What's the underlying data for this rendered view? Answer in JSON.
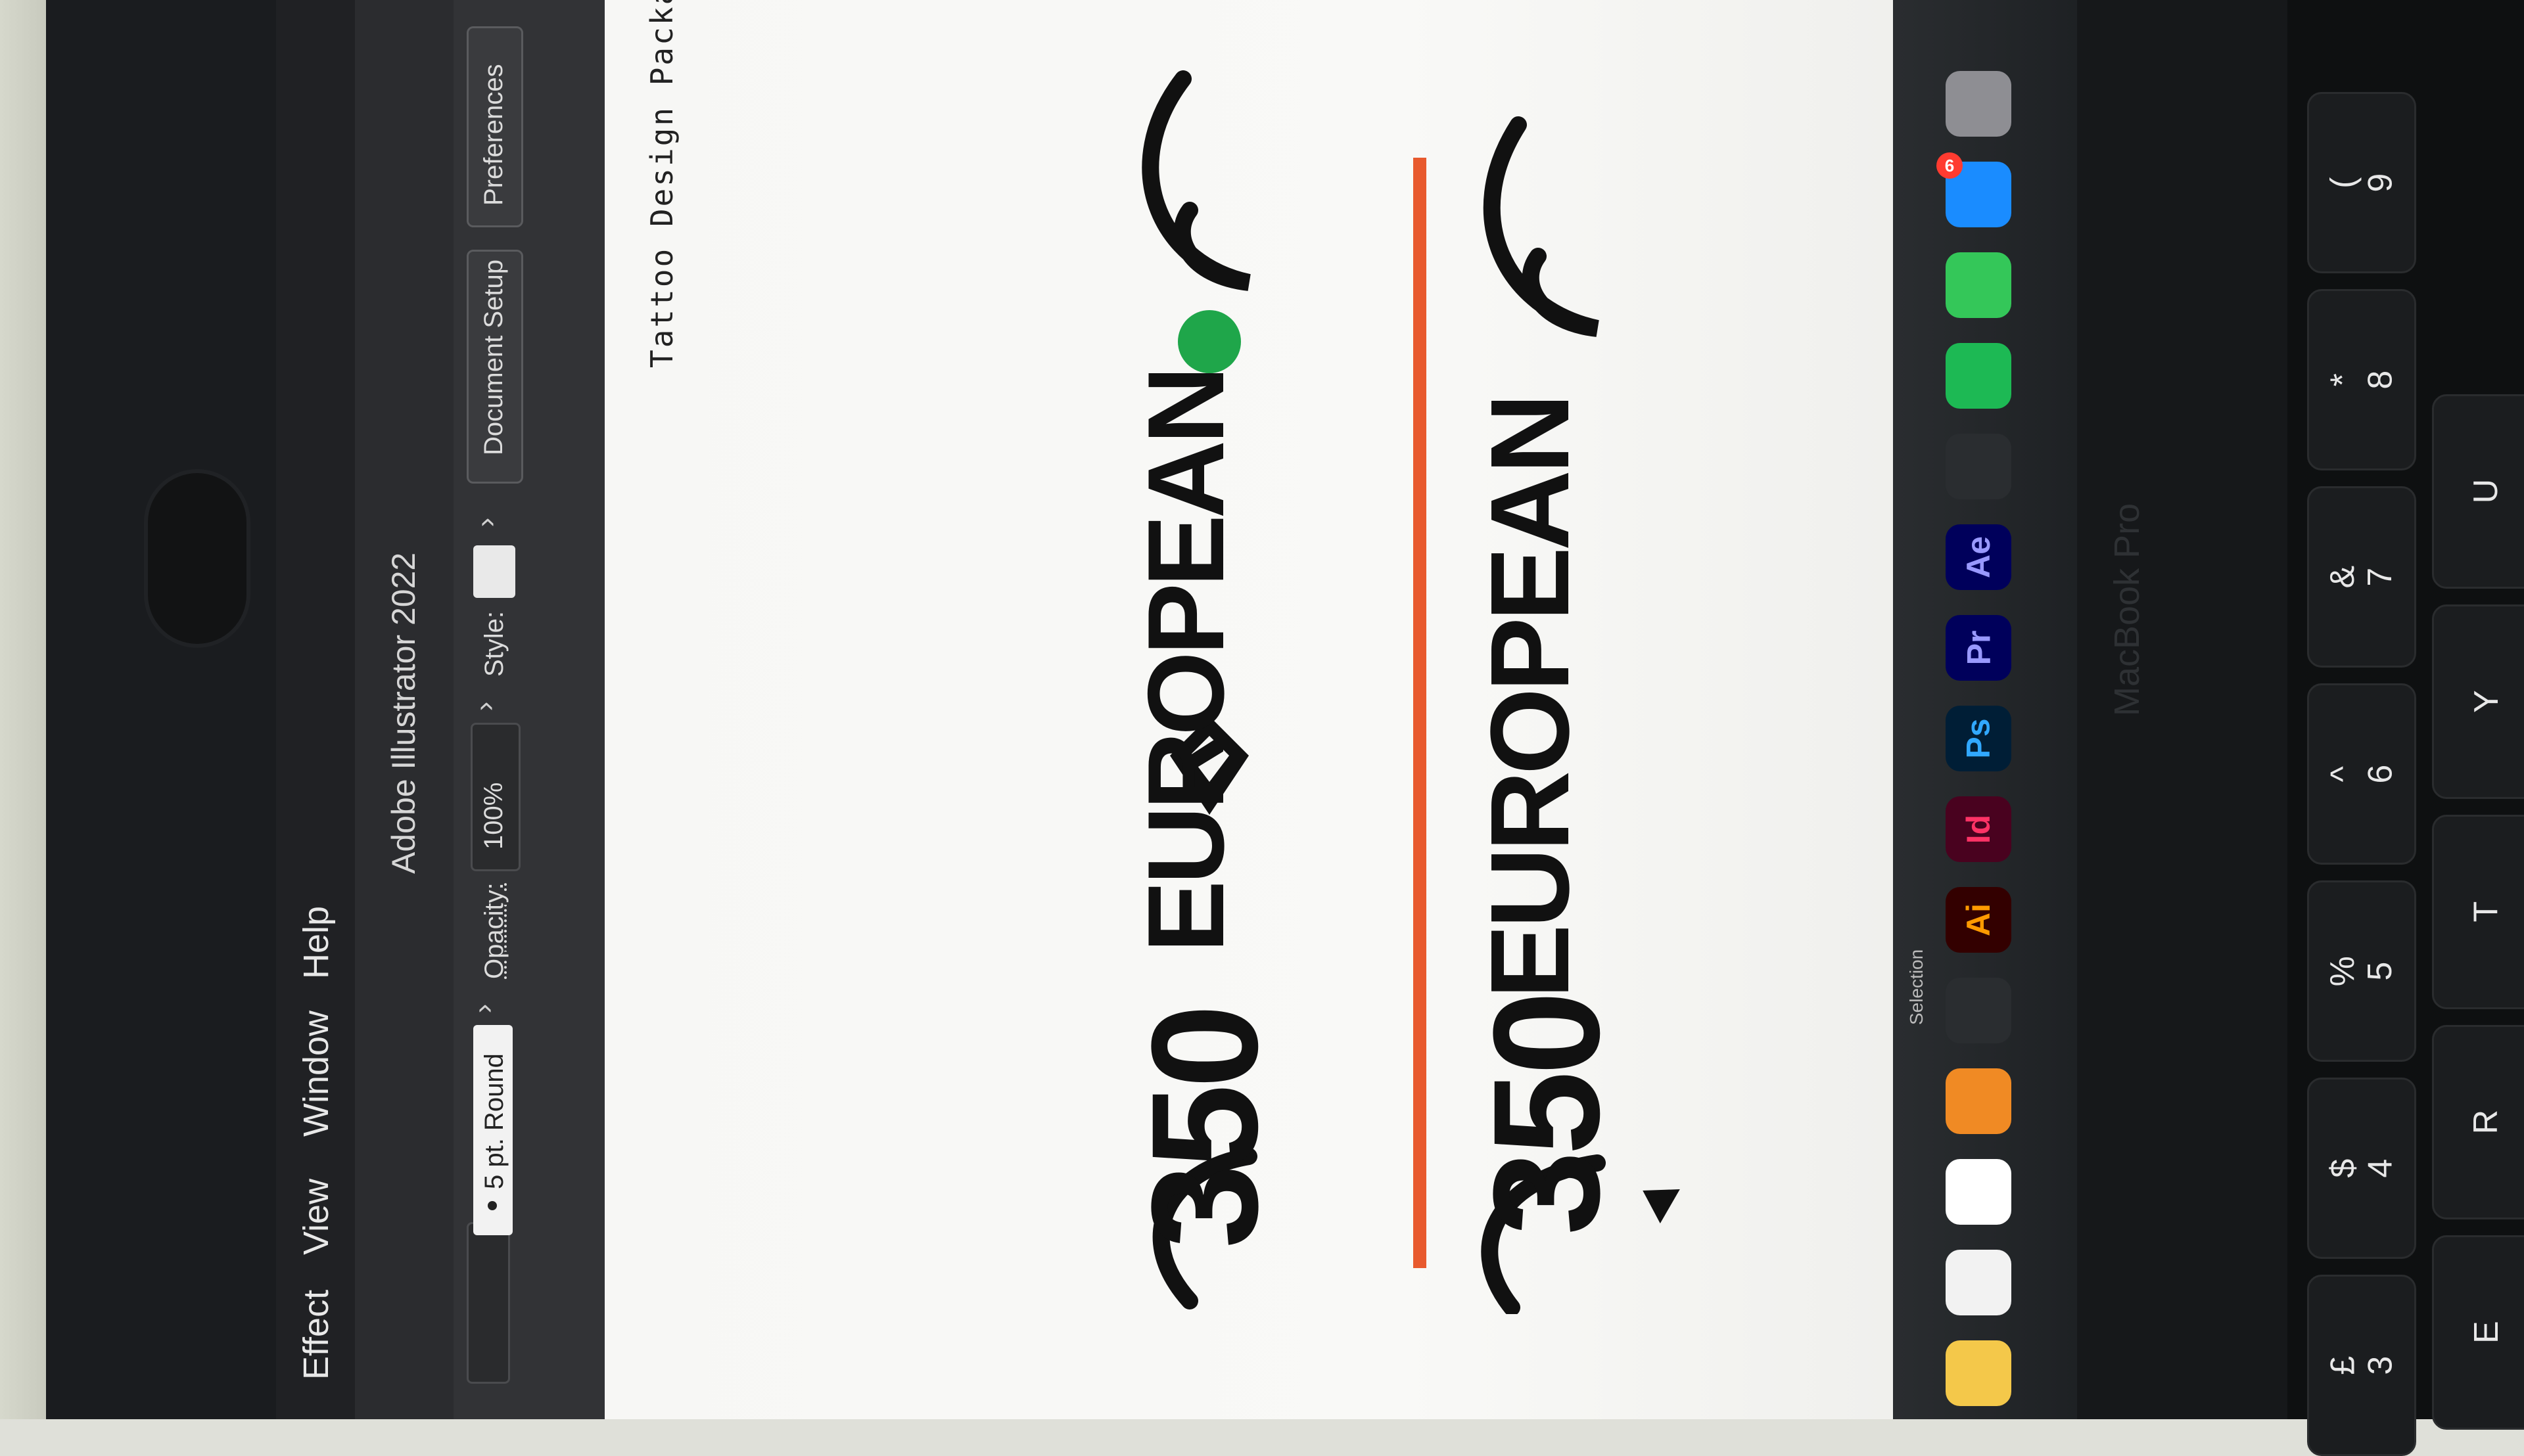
{
  "menubar": {
    "items": [
      "Effect",
      "View",
      "Window",
      "Help"
    ]
  },
  "app": {
    "title": "Adobe Illustrator 2022"
  },
  "control_bar": {
    "brush_value": "5 pt. Round",
    "opacity_label": "Opacity:",
    "opacity_value": "100%",
    "style_label": "Style:",
    "document_setup_label": "Document Setup",
    "preferences_label": "Preferences"
  },
  "artboard": {
    "small_title": "Tattoo Design Package",
    "logo_top": {
      "number": "350",
      "word": "EUROPEAN"
    },
    "logo_bottom": {
      "number": "350",
      "word": "EUROPEAN"
    }
  },
  "dock": {
    "side_label": "Selection",
    "apps": [
      {
        "name": "notes-icon",
        "text": "",
        "color": "#f4c84a"
      },
      {
        "name": "reminders-icon",
        "text": "",
        "color": "#f2f2f2"
      },
      {
        "name": "photos-icon",
        "text": "",
        "color": "#ffffff"
      },
      {
        "name": "vlc-orange-icon",
        "text": "",
        "color": "#f08a24"
      },
      {
        "name": "blender-icon",
        "text": "",
        "color": "#2a2d30"
      },
      {
        "name": "illustrator-icon",
        "text": "Ai",
        "color": "#330000"
      },
      {
        "name": "indesign-icon",
        "text": "Id",
        "color": "#49021f"
      },
      {
        "name": "photoshop-icon",
        "text": "Ps",
        "color": "#001e36"
      },
      {
        "name": "premiere-icon",
        "text": "Pr",
        "color": "#00005b"
      },
      {
        "name": "after-effects-icon",
        "text": "Ae",
        "color": "#00005b"
      },
      {
        "name": "figma-icon",
        "text": "",
        "color": "#2a2d30"
      },
      {
        "name": "spotify-icon",
        "text": "",
        "color": "#1db954"
      },
      {
        "name": "facetime-icon",
        "text": "",
        "color": "#34c759"
      },
      {
        "name": "app-store-icon",
        "text": "",
        "color": "#1a8cff"
      },
      {
        "name": "system-settings-icon",
        "text": "",
        "color": "#8e8e93"
      }
    ],
    "app_store_badge": "6"
  },
  "device": {
    "brand": "MacBook Pro"
  },
  "keyboard": {
    "row1": [
      "£\n3",
      "$\n4",
      "%\n5",
      "^\n6",
      "&\n7",
      "*\n8",
      "(\n9"
    ],
    "row2": [
      "E",
      "R",
      "T",
      "Y",
      "U"
    ]
  },
  "colors": {
    "accent_guide": "#e85a2e",
    "logo": "#111111",
    "highlight": "#1fa64a"
  }
}
